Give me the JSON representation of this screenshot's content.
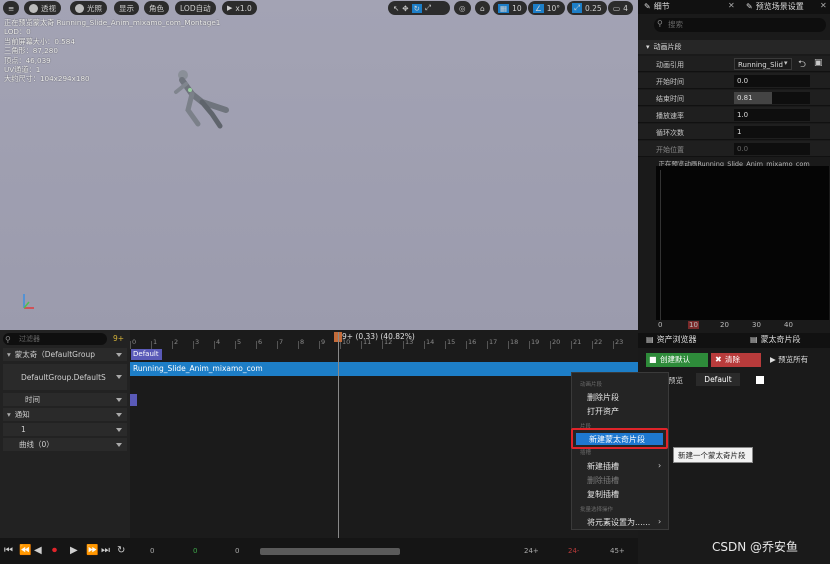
{
  "viewport": {
    "buttons": {
      "menu": "≡",
      "perspective": "透视",
      "lit": "光照",
      "show": "显示",
      "character": "角色",
      "lod": "LOD自动",
      "speed": "x1.0",
      "grid": "10",
      "angle": "10°",
      "scale": "0.25",
      "camera": "4"
    },
    "stats": [
      "正在预览蒙太奇 Running_Slide_Anim_mixamo_com_Montage1",
      "LOD：0",
      "当前屏幕大小：0.584",
      "三角形：87,280",
      "顶点：46,039",
      "UV通道：1",
      "大约尺寸：104x294x180"
    ]
  },
  "timeline": {
    "filter_placeholder": "过滤器",
    "add_count": "9+",
    "rows": {
      "montage": "蒙太奇（DefaultGroup",
      "slot": "DefaultGroup.DefaultS",
      "time": "时间",
      "notify": "通知",
      "notify_track": "1",
      "curves": "曲线（0）"
    },
    "ruler_labels": [
      "0",
      "1",
      "2",
      "3",
      "4",
      "5",
      "6",
      "7",
      "8",
      "9",
      "10",
      "11",
      "12",
      "13",
      "14",
      "15",
      "16",
      "17",
      "18",
      "19",
      "20",
      "21",
      "22",
      "23"
    ],
    "playhead_label": "9+ (0.33) (40.82%)",
    "section_chip": "Default",
    "montage_clip": "Running_Slide_Anim_mixamo_com"
  },
  "transport": {
    "start": "0",
    "current": "0",
    "frame": "0",
    "end_left": "24+",
    "end_mid": "24-",
    "end_right": "45+"
  },
  "context_menu": {
    "section1": "动画片段",
    "delete_segment": "删除片段",
    "open_asset": "打开资产",
    "section2": "片段",
    "new_montage_segment": "新建蒙太奇片段",
    "section3": "插槽",
    "new_slot": "新建插槽",
    "delete_slot": "删除插槽",
    "duplicate_slot": "复制插槽",
    "section4": "批量选择操作",
    "set_elements": "将元素设置为......"
  },
  "tooltip": "新建一个蒙太奇片段",
  "details": {
    "tab_details": "细节",
    "tab_preview": "预览场景设置",
    "search_placeholder": "搜索",
    "category": "动画片段",
    "props": [
      {
        "label": "动画引用",
        "value": "Running_Slid"
      },
      {
        "label": "开始时间",
        "value": "0.0"
      },
      {
        "label": "结束时间",
        "value": "0.81"
      },
      {
        "label": "播放速率",
        "value": "1.0"
      },
      {
        "label": "循环次数",
        "value": "1"
      },
      {
        "label": "开始位置",
        "value": "0.0"
      }
    ],
    "preview_caption": "正在预览动画Running_Slide_Anim_mixamo_com",
    "ruler": [
      "0",
      "10",
      "20",
      "30",
      "40"
    ]
  },
  "montage_panel": {
    "tab_browser": "资产浏览器",
    "tab_sections": "蒙太奇片段",
    "create_default": "创建默认",
    "clear": "清除",
    "preview_all": "预览所有",
    "preview": "预览",
    "default_label": "Default"
  },
  "watermark": "CSDN @乔安鱼",
  "colors": {
    "accent_blue": "#1d7ec7",
    "highlight_red": "#e0242a",
    "create_green": "#2e8b3a",
    "clear_red": "#b83b3b"
  }
}
